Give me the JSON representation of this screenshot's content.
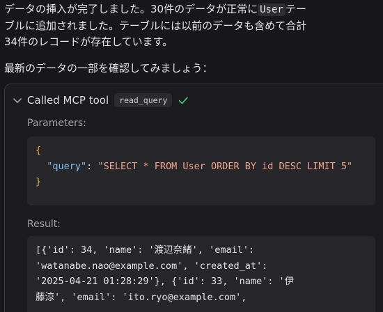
{
  "message": {
    "line1_before": "データの挿入が完了しました。30件のデータが正常に",
    "line1_code": "User",
    "line1_after": "テー",
    "line2": "ブルに追加されました。テーブルには以前のデータも含めて合計",
    "line3": "34件のレコードが存在しています。",
    "line4": "最新のデータの一部を確認してみましょう："
  },
  "tool_call": {
    "title": "Called MCP tool",
    "tool_name": "read_query",
    "chevron_icon": "chevron-down-icon",
    "status_icon": "checkmark-icon",
    "parameters_label": "Parameters:",
    "param_key": "\"query\"",
    "param_value": "\"SELECT * FROM User ORDER BY id DESC LIMIT 5\"",
    "result_label": "Result:",
    "result_lines": [
      "[{'id': 34, 'name': '渡辺奈緒', 'email':",
      "'watanabe.nao@example.com', 'created_at':",
      "'2025-04-21 01:28:29'}, {'id': 33, 'name': '伊",
      "藤涼', 'email': 'ito.ryo@example.com',"
    ]
  },
  "colors": {
    "background": "#18181b",
    "card": "#1c1c20",
    "code_bg": "#27272b",
    "key": "#7cc4f5",
    "string": "#f0a58a",
    "brace": "#e8b84a",
    "check": "#4ade80"
  }
}
